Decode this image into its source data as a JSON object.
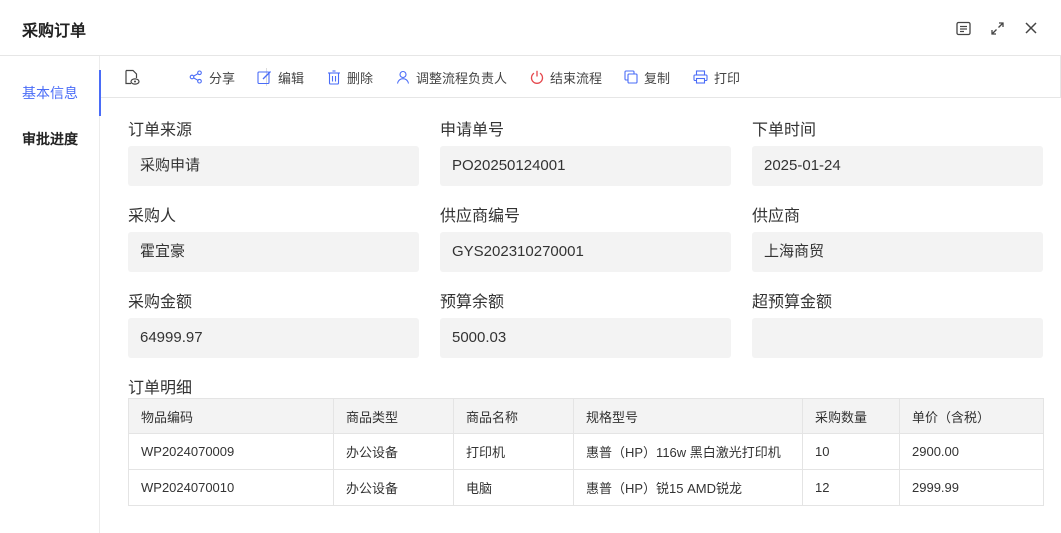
{
  "window": {
    "title": "采购订单",
    "icons": [
      "document-icon",
      "expand-icon",
      "close-icon"
    ]
  },
  "sidebar": {
    "items": [
      {
        "label": "基本信息",
        "active": true
      },
      {
        "label": "审批进度",
        "active": false
      }
    ]
  },
  "toolbar": {
    "view_icon": "view-icon",
    "share": "分享",
    "edit": "编辑",
    "delete": "删除",
    "reassign": "调整流程负责人",
    "end_flow": "结束流程",
    "copy": "复制",
    "print": "打印"
  },
  "colors": {
    "accent": "#4a6cf7",
    "danger": "#e5484d",
    "field_bg": "#f3f3f3"
  },
  "form": {
    "order_source": {
      "label": "订单来源",
      "value": "采购申请"
    },
    "request_no": {
      "label": "申请单号",
      "value": "PO20250124001"
    },
    "order_time": {
      "label": "下单时间",
      "value": "2025-01-24"
    },
    "buyer": {
      "label": "采购人",
      "value": "霍宜豪"
    },
    "supplier_code": {
      "label": "供应商编号",
      "value": "GYS202310270001"
    },
    "supplier": {
      "label": "供应商",
      "value": "上海商贸"
    },
    "amount": {
      "label": "采购金额",
      "value": "64999.97"
    },
    "budget_left": {
      "label": "预算余额",
      "value": "5000.03"
    },
    "over_budget": {
      "label": "超预算金额",
      "value": ""
    }
  },
  "details": {
    "title": "订单明细",
    "columns": [
      "物品编码",
      "商品类型",
      "商品名称",
      "规格型号",
      "采购数量",
      "单价（含税）"
    ],
    "rows": [
      [
        "WP2024070009",
        "办公设备",
        "打印机",
        "惠普（HP）116w 黑白激光打印机",
        "10",
        "2900.00"
      ],
      [
        "WP2024070010",
        "办公设备",
        "电脑",
        "惠普（HP）锐15 AMD锐龙",
        "12",
        "2999.99"
      ]
    ]
  }
}
